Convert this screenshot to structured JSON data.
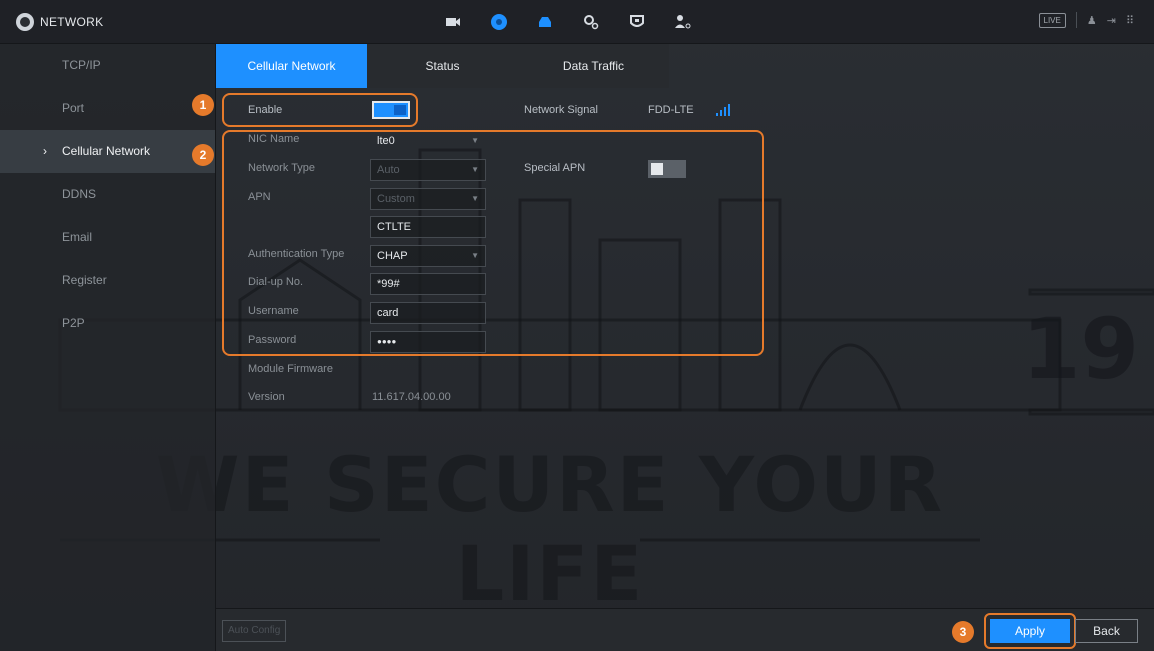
{
  "app": {
    "title": "NETWORK",
    "live_label": "LIVE"
  },
  "top_nav": [
    {
      "icon": "camera-icon"
    },
    {
      "icon": "network-icon"
    },
    {
      "icon": "storage-icon"
    },
    {
      "icon": "settings-icon"
    },
    {
      "icon": "security-icon"
    },
    {
      "icon": "account-icon"
    }
  ],
  "sidebar": {
    "items": [
      {
        "label": "TCP/IP"
      },
      {
        "label": "Port"
      },
      {
        "label": "Cellular Network"
      },
      {
        "label": "DDNS"
      },
      {
        "label": "Email"
      },
      {
        "label": "Register"
      },
      {
        "label": "P2P"
      }
    ]
  },
  "tabs": [
    {
      "label": "Cellular Network"
    },
    {
      "label": "Status"
    },
    {
      "label": "Data Traffic"
    }
  ],
  "form": {
    "enable_label": "Enable",
    "enable_value": true,
    "network_signal_label": "Network Signal",
    "network_signal_value": "FDD-LTE",
    "nic_name_label": "NIC Name",
    "nic_name_value": "lte0",
    "network_type_label": "Network Type",
    "network_type_value": "Auto",
    "special_apn_label": "Special APN",
    "special_apn_value": false,
    "apn_label": "APN",
    "apn_value": "Custom",
    "apn_custom_value": "CTLTE",
    "auth_type_label": "Authentication Type",
    "auth_type_value": "CHAP",
    "dialup_label": "Dial-up No.",
    "dialup_value": "*99#",
    "username_label": "Username",
    "username_value": "card",
    "password_label": "Password",
    "password_value": "●●●●",
    "module_firmware_label": "Module Firmware",
    "version_label": "Version",
    "version_value": "11.617.04.00.00"
  },
  "callouts": [
    "1",
    "2",
    "3"
  ],
  "footer": {
    "auto_config_label": "Auto Config",
    "apply_label": "Apply",
    "back_label": "Back"
  },
  "background": {
    "watermark_text": "WE SECURE YOUR LIFE",
    "watermark_number": "19"
  },
  "colors": {
    "accent": "#1e90ff",
    "callout": "#e57a2b",
    "background": "#26292e"
  }
}
